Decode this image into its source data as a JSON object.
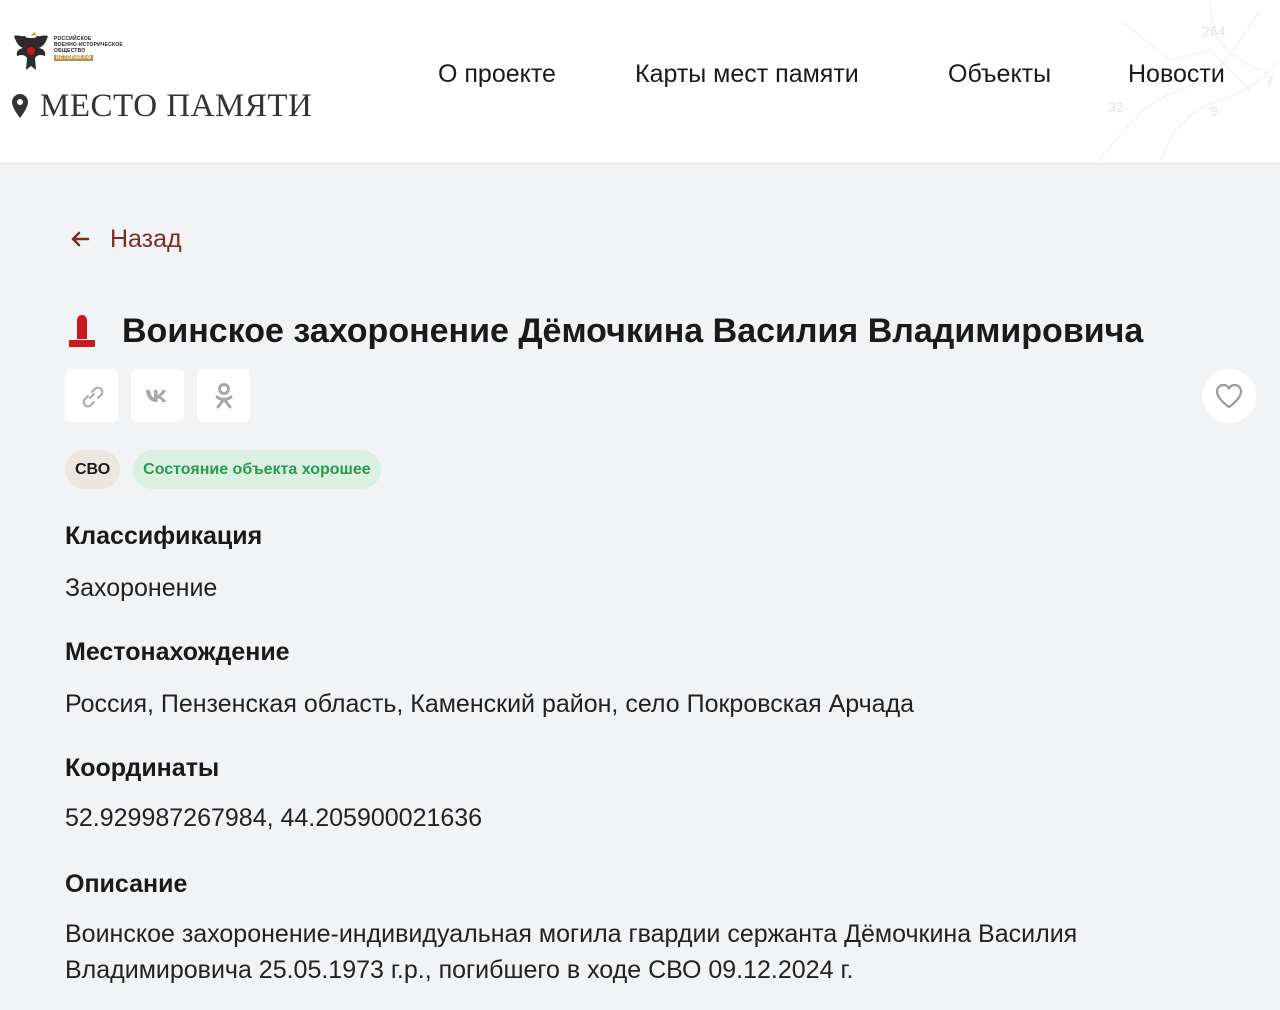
{
  "header": {
    "org_lines": [
      "РОССИЙСКОЕ",
      "ВОЕННО-ИСТОРИЧЕСКОЕ",
      "ОБЩЕСТВО"
    ],
    "org_badge": "ИСТОРИЯ.РФ",
    "brand_title": "МЕСТО ПАМЯТИ",
    "nav": [
      {
        "label": "О проекте"
      },
      {
        "label": "Карты мест памяти"
      },
      {
        "label": "Объекты"
      },
      {
        "label": "Новости"
      }
    ],
    "map_labels": [
      "264",
      "32",
      "9",
      "7"
    ]
  },
  "back_label": "Назад",
  "title": "Воинское захоронение Дёмочкина Василия Владимировича",
  "share_icons": [
    "link-icon",
    "vk-icon",
    "odnoklassniki-icon"
  ],
  "favorite_icon": "heart-icon",
  "tags": [
    "СВО",
    "Состояние объекта хорошее"
  ],
  "colors": {
    "accent": "#7b2d22",
    "marker": "#c8191e",
    "tag_state_bg": "#dcefe3",
    "tag_state_text": "#2a9a4d",
    "page_bg": "#f2f3f5"
  },
  "sections": {
    "classification": {
      "heading": "Классификация",
      "value": "Захоронение"
    },
    "location": {
      "heading": "Местонахождение",
      "value": "Россия, Пензенская область, Каменский район, село Покровская Арчада"
    },
    "coordinates": {
      "heading": "Координаты",
      "value": "52.929987267984, 44.205900021636"
    },
    "description": {
      "heading": "Описание",
      "lines": [
        "Воинское захоронение-индивидуальная могила гвардии сержанта Дёмочкина Василия",
        "Владимировича 25.05.1973 г.р., погибшего в ходе СВО 09.12.2024 г."
      ]
    }
  }
}
